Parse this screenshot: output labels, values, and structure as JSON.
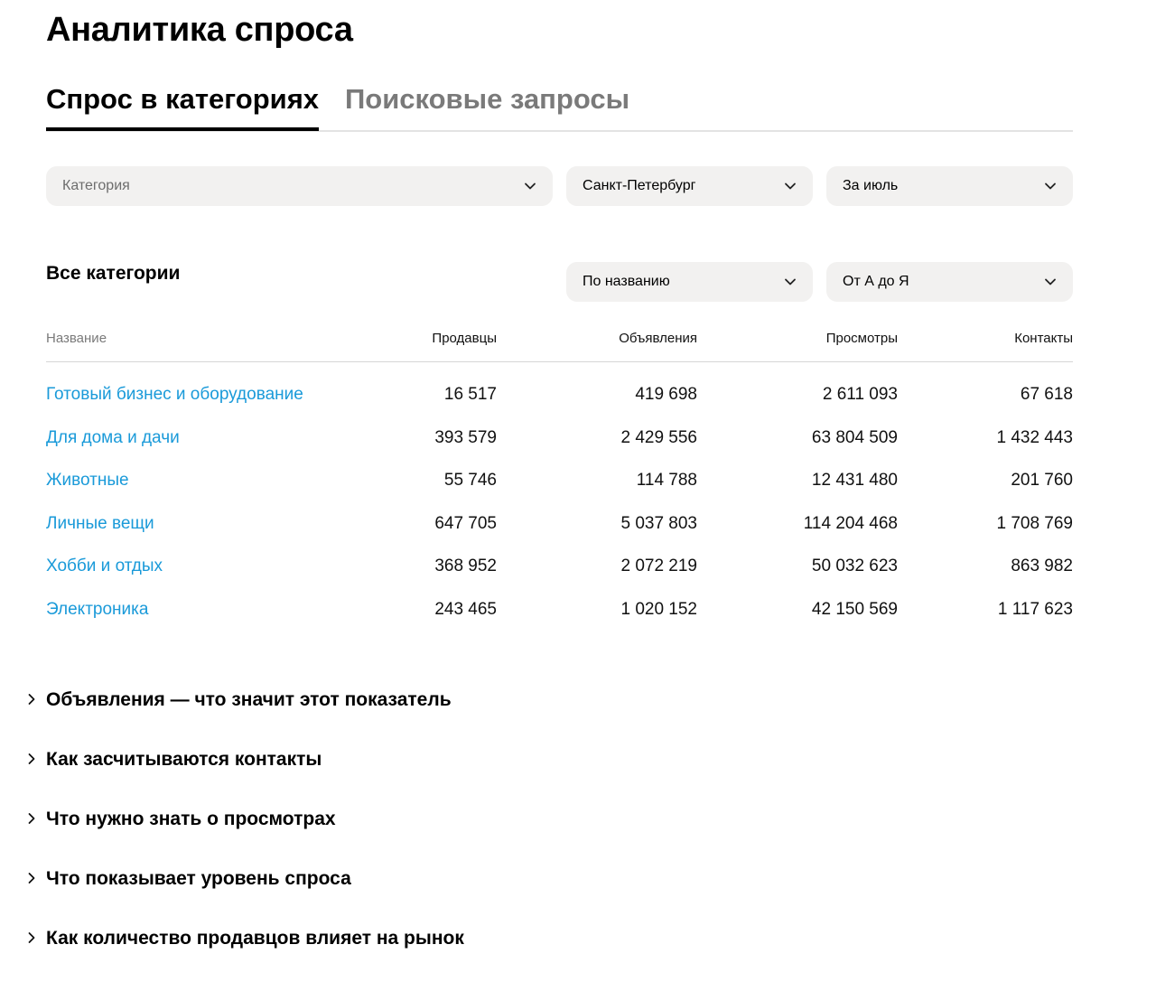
{
  "page": {
    "title": "Аналитика спроса"
  },
  "tabs": [
    {
      "label": "Спрос в категориях",
      "active": true
    },
    {
      "label": "Поисковые запросы",
      "active": false
    }
  ],
  "filters": {
    "category": {
      "placeholder": "Категория",
      "icon": "chevron-down-icon"
    },
    "city": {
      "value": "Санкт-Петербург",
      "icon": "chevron-down-icon"
    },
    "period": {
      "value": "За июль",
      "icon": "chevron-down-icon"
    }
  },
  "section": {
    "title": "Все категории"
  },
  "sort": {
    "field": {
      "value": "По названию",
      "icon": "chevron-down-icon"
    },
    "order": {
      "value": "От А до Я",
      "icon": "chevron-down-icon"
    }
  },
  "table": {
    "headers": [
      "Название",
      "Продавцы",
      "Объявления",
      "Просмотры",
      "Контакты"
    ],
    "rows": [
      [
        "Готовый бизнес и оборудование",
        "16 517",
        "419 698",
        "2 611 093",
        "67 618"
      ],
      [
        "Для дома и дачи",
        "393 579",
        "2 429 556",
        "63 804 509",
        "1 432 443"
      ],
      [
        "Животные",
        "55 746",
        "114 788",
        "12 431 480",
        "201 760"
      ],
      [
        "Личные вещи",
        "647 705",
        "5 037 803",
        "114 204 468",
        "1 708 769"
      ],
      [
        "Хобби и отдых",
        "368 952",
        "2 072 219",
        "50 032 623",
        "863 982"
      ],
      [
        "Электроника",
        "243 465",
        "1 020 152",
        "42 150 569",
        "1 117 623"
      ]
    ]
  },
  "faq": [
    "Объявления — что значит этот показатель",
    "Как засчитываются контакты",
    "Что нужно знать о просмотрах",
    "Что показывает уровень спроса",
    "Как количество продавцов влияет на рынок"
  ],
  "colors": {
    "link": "#1a9ad9",
    "select_bg": "#f2f1f0",
    "muted": "#7a7a7a",
    "tab_underline": "#000000"
  }
}
